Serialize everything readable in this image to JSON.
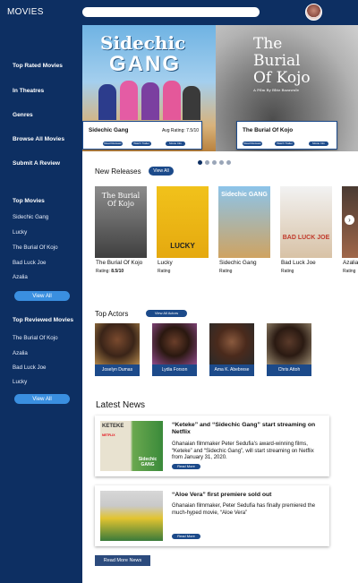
{
  "app": {
    "title": "MOVIES",
    "search_placeholder": ""
  },
  "sidebar": {
    "nav": [
      "Top Rated Movies",
      "In Theatres",
      "Genres",
      "Browse All Movies",
      "Submit A Review"
    ],
    "top_movies": {
      "heading": "Top Movies",
      "items": [
        "Sidechic Gang",
        "Lucky",
        "The Burial Of Kojo",
        "Bad Luck Joe",
        "Azalia"
      ],
      "view_all": "View All"
    },
    "top_reviewed": {
      "heading": "Top Reviewed Movies",
      "items": [
        "The Burial Of Kojo",
        "Azalia",
        "Bad Luck Joe",
        "Lucky"
      ],
      "view_all": "View All"
    }
  },
  "hero": {
    "slides": [
      {
        "logo_top": "Sidechic",
        "logo_bottom": "GANG",
        "title": "Sidechic Gang",
        "rating": "Avg Rating: 7.5/10",
        "buttons": [
          "Read Reviews",
          "Watch Trailer",
          "Movie Info"
        ]
      },
      {
        "poster_title_line1": "The",
        "poster_title_line2": "Burial",
        "poster_title_line3": "Of Kojo",
        "poster_credit": "A Film By Blitz Bazawule",
        "title": "The Burial Of Kojo",
        "rating": "Avg Rating: 8.5/10",
        "buttons": [
          "Read Reviews",
          "Watch Trailer",
          "Movie Info"
        ]
      }
    ],
    "active_dot": 0,
    "dot_count": 5
  },
  "new_releases": {
    "heading": "New Releases",
    "view_all": "View All",
    "movies": [
      {
        "title": "The Burial Of Kojo",
        "rating_label": "Rating:",
        "rating_value": "8.5/10",
        "poster_text": "The Burial Of Kojo"
      },
      {
        "title": "Lucky",
        "rating_label": "Rating",
        "rating_value": "",
        "poster_text": "LUCKY"
      },
      {
        "title": "Sidechic Gang",
        "rating_label": "Rating",
        "rating_value": "",
        "poster_text": "Sidechic GANG"
      },
      {
        "title": "Bad Luck Joe",
        "rating_label": "Rating",
        "rating_value": "",
        "poster_text": "BAD LUCK JOE"
      },
      {
        "title": "Azalia",
        "rating_label": "Rating",
        "rating_value": "",
        "poster_text": ""
      }
    ],
    "next_icon": "chevron-right-icon"
  },
  "top_actors": {
    "heading": "Top Actors",
    "view_all": "View All Actors",
    "actors": [
      "Joselyn Dumas",
      "Lydia Forson",
      "Ama K. Abebrese",
      "Chris Attoh"
    ]
  },
  "latest_news": {
    "heading": "Latest News",
    "items": [
      {
        "title": "“Keteke” and “Sidechic Gang” start streaming on Netflix",
        "body": "Ghanaian filmmaker Peter Sedufia's award-winning films, “Keteke” and “Sidechic Gang”, will start streaming on Netflix from January 31, 2020.",
        "read_more": "Read More",
        "image_text_top": "KETEKE",
        "image_text_bottom": "Sidechic GANG",
        "badge": "NETFLIX"
      },
      {
        "title": "“Aloe Vera” first premiere sold out",
        "body": "Ghanaian filmmaker, Peter Sedufia has finally premiered the much-hyped movie, “Aloe Vera”",
        "read_more": "Read More"
      }
    ],
    "read_more_news": "Read More News"
  },
  "colors": {
    "navy": "#0d2f62",
    "button_blue": "#1c4a8a",
    "light_blue": "#3a8fe0"
  }
}
